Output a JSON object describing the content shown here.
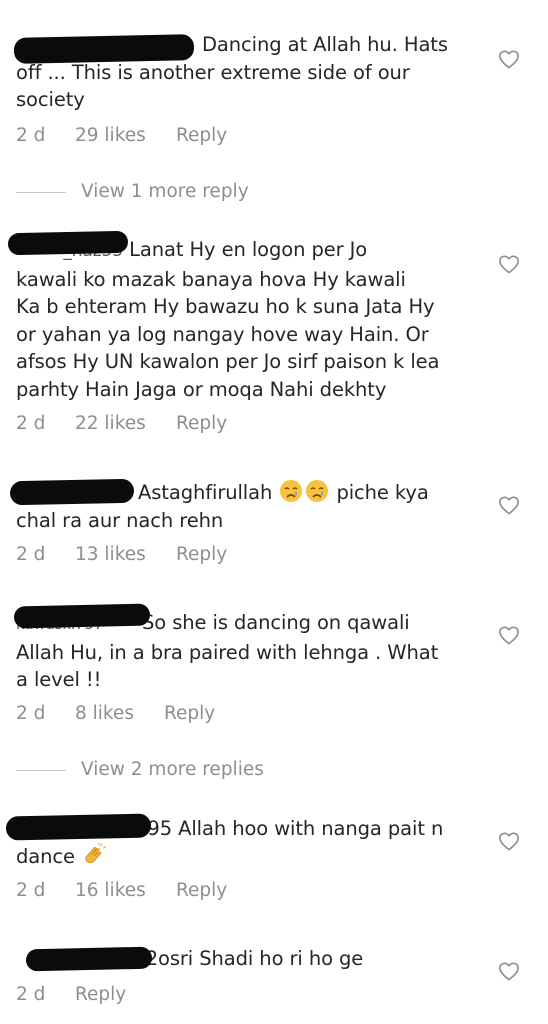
{
  "comments": [
    {
      "text_1": "Dancing at Allah hu. Hats",
      "text_2": "off ... This is another extreme side of our",
      "text_3": "society",
      "age": "2 d",
      "likes": "29 likes",
      "reply": "Reply",
      "view_replies": "View 1 more reply"
    },
    {
      "user_tail": "_haz55",
      "text_1": "Lanat Hy en logon per Jo",
      "text_2": "kawali ko mazak banaya hova Hy kawali",
      "text_3": "Ka b ehteram Hy bawazu ho k suna Jata Hy",
      "text_4": "or yahan ya log nangay hove way Hain. Or",
      "text_5": "afsos Hy UN kawalon per Jo sirf paison k lea",
      "text_6": "parhty Hain Jaga or moqa Nahi dekhty",
      "age": "2 d",
      "likes": "22 likes",
      "reply": "Reply"
    },
    {
      "text_1": "Astaghfirullah",
      "text_2": "piche kya",
      "text_3": "chal ra aur nach rehn",
      "emoji": "crying-face-emoji",
      "age": "2 d",
      "likes": "13 likes",
      "reply": "Reply"
    },
    {
      "user_tail": "kawaski757",
      "text_1": "So she is dancing on qawali",
      "text_2": "Allah Hu, in a bra paired with lehnga . What",
      "text_3": "a level !!",
      "age": "2 d",
      "likes": "8 likes",
      "reply": "Reply",
      "view_replies": "View 2 more replies"
    },
    {
      "user_tail": "795",
      "text_1": "Allah hoo with nanga pait n",
      "text_2": "dance",
      "emoji": "clapping-hands-emoji",
      "age": "2 d",
      "likes": "16 likes",
      "reply": "Reply"
    },
    {
      "user_tail": "2",
      "text_1": "osri Shadi ho ri ho ge",
      "age": "2 d",
      "reply": "Reply"
    }
  ],
  "icons": {
    "like": "heart-outline-icon"
  },
  "colors": {
    "text": "#262626",
    "secondary": "#8e8e8e",
    "redaction": "#0b0b0b",
    "divider": "#c7c7c7"
  }
}
